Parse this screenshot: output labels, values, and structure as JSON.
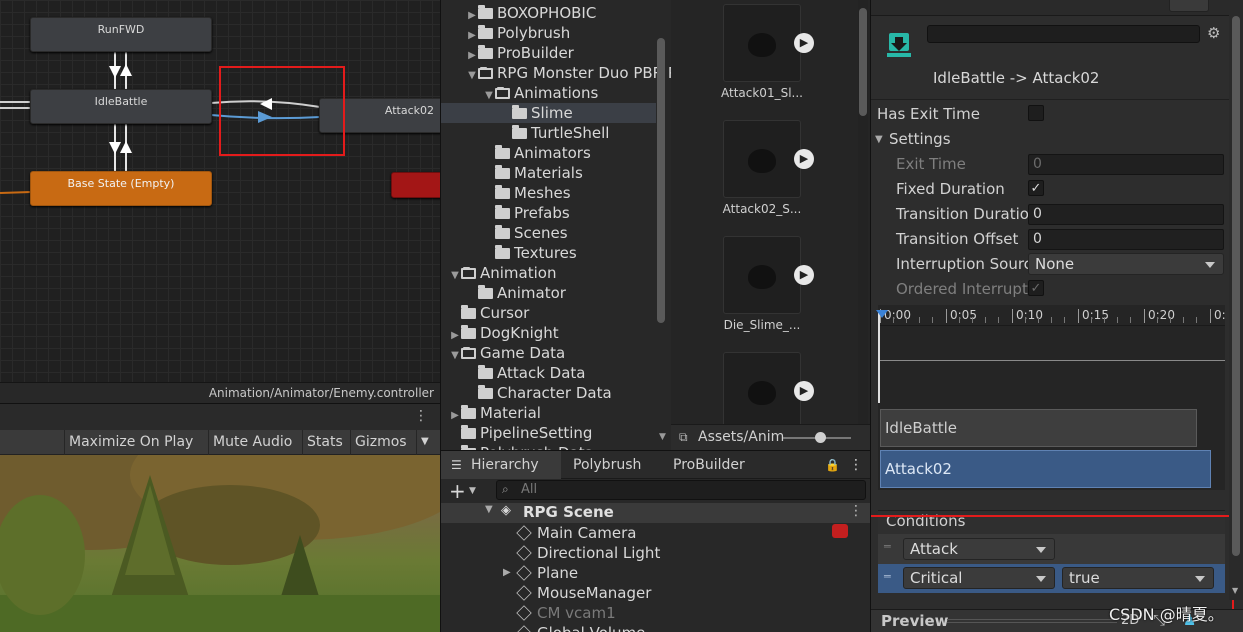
{
  "animator": {
    "nodes": {
      "runfwd": "RunFWD",
      "idlebattle": "IdleBattle",
      "base_state": "Base State  (Empty)",
      "attack02": "Attack02"
    },
    "path": "Animation/Animator/Enemy.controller"
  },
  "game_toolbar": {
    "maximize": "Maximize On Play",
    "mute": "Mute Audio",
    "stats": "Stats",
    "gizmos": "Gizmos"
  },
  "project": {
    "tree": [
      {
        "label": "BOXOPHOBIC",
        "arrow": "▶"
      },
      {
        "label": "Polybrush",
        "arrow": "▶"
      },
      {
        "label": "ProBuilder",
        "arrow": "▶"
      },
      {
        "label": "RPG Monster Duo PBR Polyart",
        "arrow": "▼"
      },
      {
        "label": "Animations",
        "arrow": "▼"
      },
      {
        "label": "Slime",
        "arrow": ""
      },
      {
        "label": "TurtleShell",
        "arrow": ""
      },
      {
        "label": "Animators",
        "arrow": ""
      },
      {
        "label": "Materials",
        "arrow": ""
      },
      {
        "label": "Meshes",
        "arrow": ""
      },
      {
        "label": "Prefabs",
        "arrow": ""
      },
      {
        "label": "Scenes",
        "arrow": ""
      },
      {
        "label": "Textures",
        "arrow": ""
      },
      {
        "label": "Animation",
        "arrow": "▼"
      },
      {
        "label": "Animator",
        "arrow": ""
      },
      {
        "label": "Cursor",
        "arrow": ""
      },
      {
        "label": "DogKnight",
        "arrow": "▶"
      },
      {
        "label": "Game Data",
        "arrow": "▼"
      },
      {
        "label": "Attack Data",
        "arrow": ""
      },
      {
        "label": "Character Data",
        "arrow": ""
      },
      {
        "label": "Material",
        "arrow": "▶"
      },
      {
        "label": "PipelineSetting",
        "arrow": ""
      },
      {
        "label": "Polybrush Data",
        "arrow": "▶"
      }
    ],
    "assets": [
      "Attack01_Sl...",
      "Attack02_S...",
      "Die_Slime_...",
      ""
    ],
    "breadcrumb": "Assets/Anim"
  },
  "hierarchy": {
    "tabs": [
      "Hierarchy",
      "Polybrush",
      "ProBuilder"
    ],
    "search_placeholder": "All",
    "scene": "RPG Scene",
    "items": [
      "Main Camera",
      "Directional Light",
      "Plane",
      "MouseManager",
      "CM vcam1",
      "Global Volume"
    ]
  },
  "inspector": {
    "title": "IdleBattle -> Attack02",
    "has_exit_time": "Has Exit Time",
    "settings": "Settings",
    "exit_time": {
      "label": "Exit Time",
      "value": "0"
    },
    "fixed_duration": {
      "label": "Fixed Duration",
      "checked": "✓"
    },
    "transition_duration": {
      "label": "Transition Duratio",
      "value": "0"
    },
    "transition_offset": {
      "label": "Transition Offset",
      "value": "0"
    },
    "interruption_source": {
      "label": "Interruption Sourc",
      "value": "None"
    },
    "ordered_interruption": {
      "label": "Ordered Interruptic",
      "checked": "✓"
    },
    "timeline_ticks": [
      "0:00",
      "0:05",
      "0:10",
      "0:15",
      "0:20",
      "0:"
    ],
    "timeline_states": [
      "IdleBattle",
      "Attack02"
    ],
    "conditions": {
      "title": "Conditions",
      "rows": [
        {
          "param": "Attack",
          "value": ""
        },
        {
          "param": "Critical",
          "value": "true"
        }
      ]
    },
    "preview": "Preview",
    "preview_2d": "2D",
    "watermark": "CSDN @晴夏。"
  }
}
